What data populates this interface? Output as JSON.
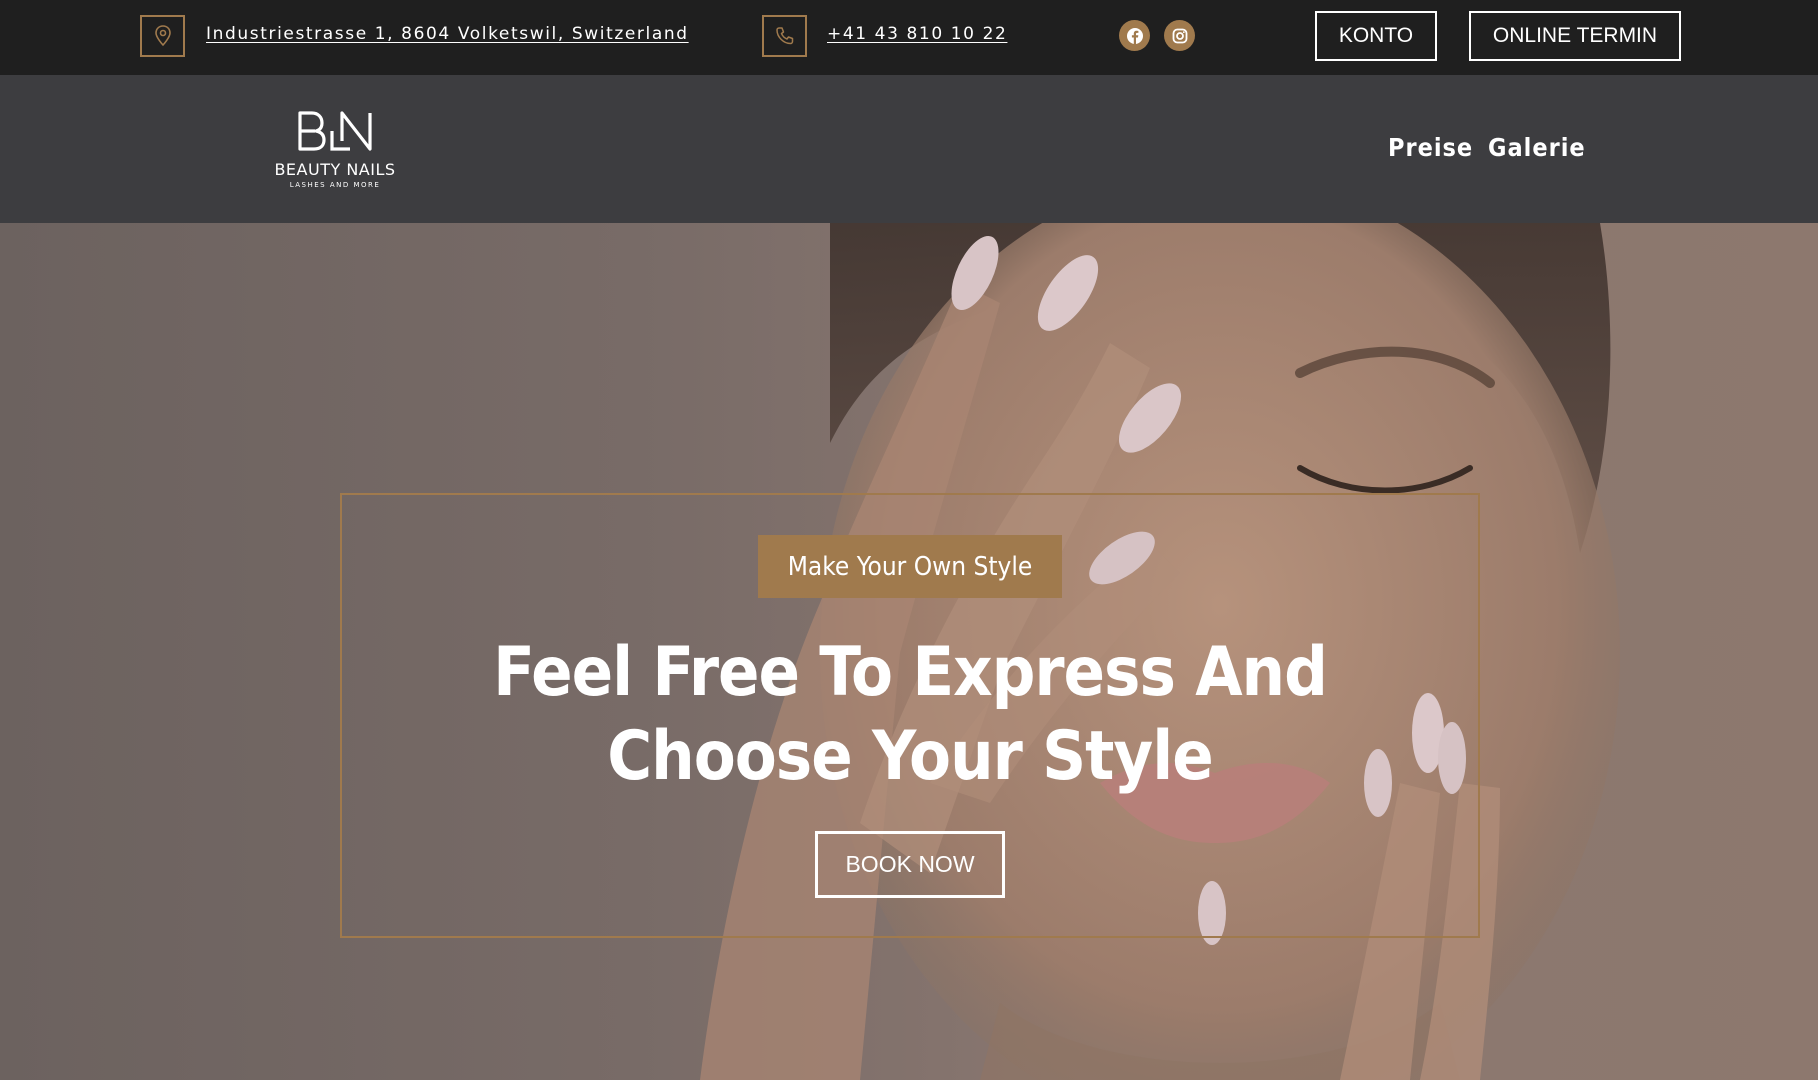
{
  "topbar": {
    "address": "Industriestrasse 1, 8604 Volketswil, Switzerland",
    "phone": "+41 43 810 10 22",
    "account_label": "KONTO",
    "booking_label": "ONLINE TERMIN",
    "icons": [
      "location-pin-icon",
      "phone-icon",
      "facebook-icon",
      "instagram-icon"
    ]
  },
  "header": {
    "logo_name": "BEAUTY NAILS",
    "logo_sub": "LASHES AND MORE",
    "nav": [
      "Preise",
      "Galerie"
    ]
  },
  "hero": {
    "tagline": "Make Your Own Style",
    "headline": "Feel Free To Express And Choose Your Style",
    "button_label": "BOOK NOW"
  },
  "colors": {
    "accent": "#a07a4d",
    "topbar_bg": "#1f1f1f",
    "header_bg": "#3d3d40",
    "text": "#ffffff"
  }
}
